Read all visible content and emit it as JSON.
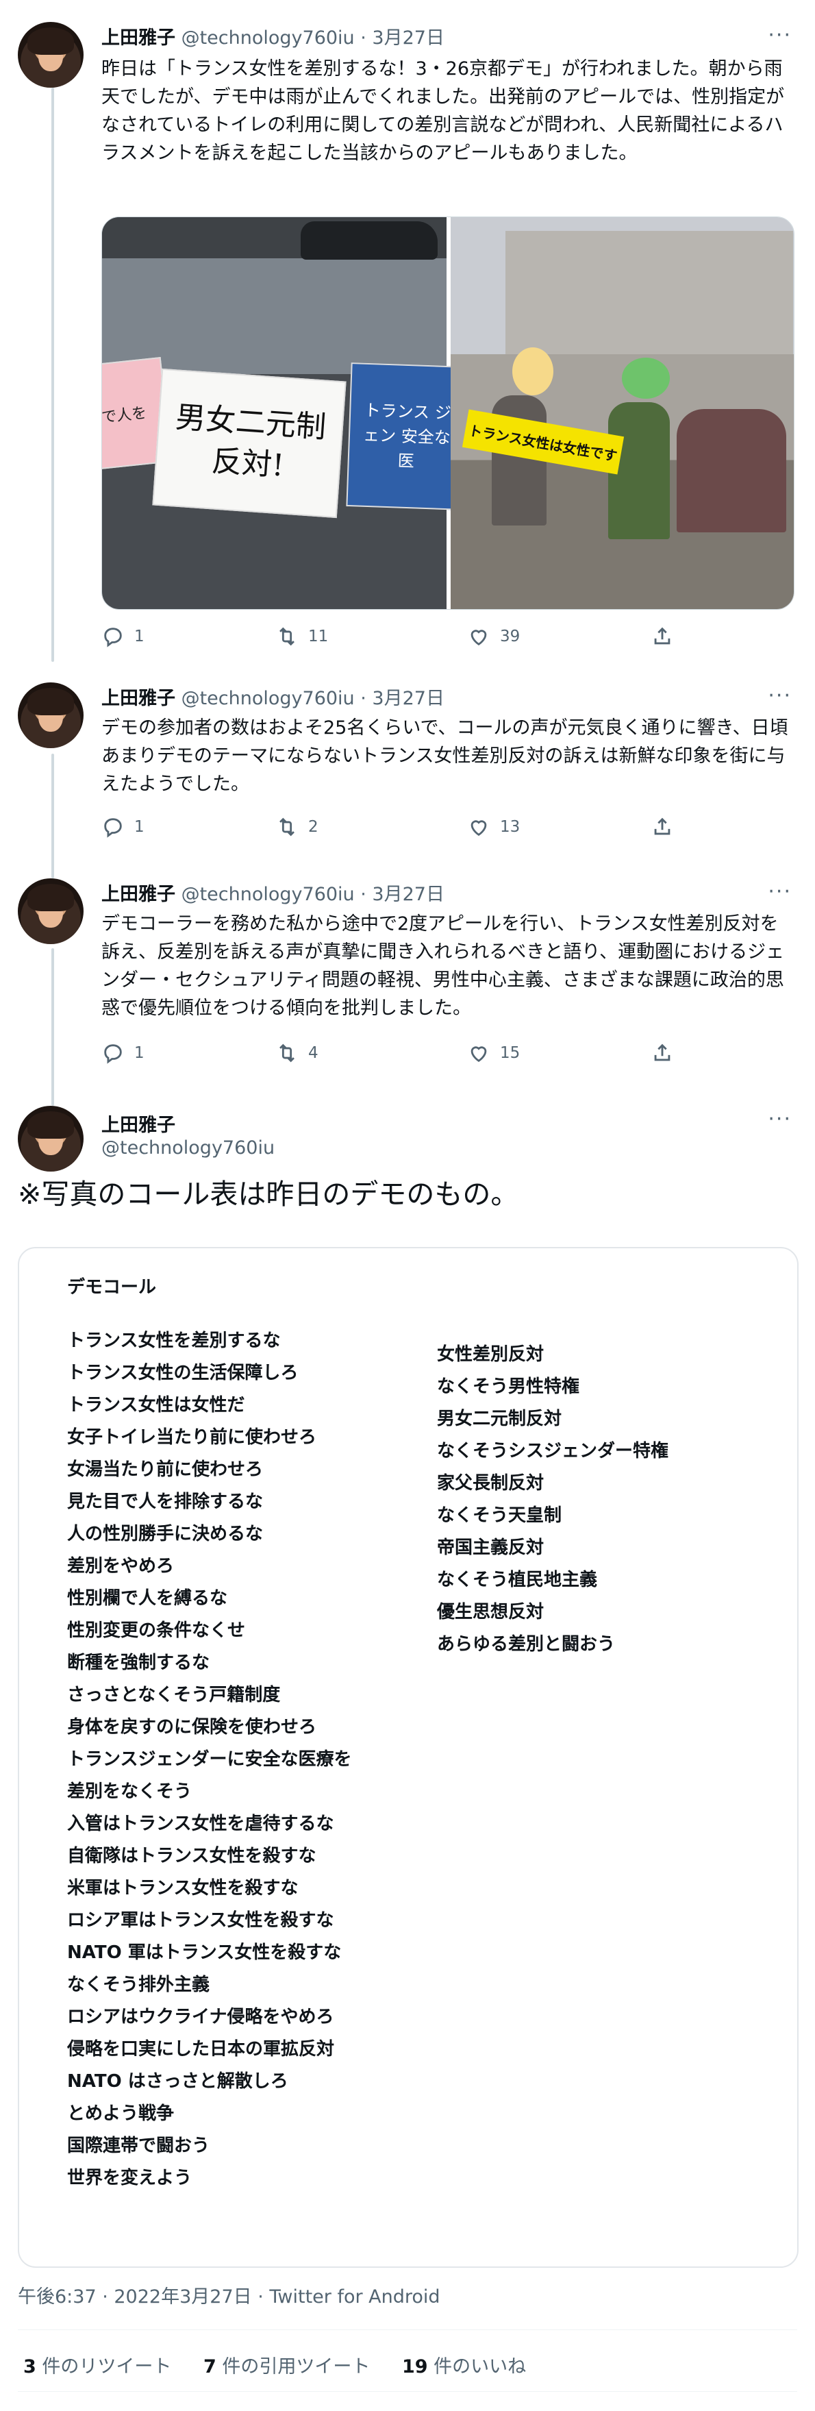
{
  "author": {
    "name": "上田雅子",
    "handle": "@technology760iu"
  },
  "tweets": [
    {
      "date": "3月27日",
      "text": "昨日は「トランス女性を差別するな！3・26京都デモ」が行われました。朝から雨天でしたが、デモ中は雨が止んでくれました。出発前のアピールでは、性別指定がなされているトイレの利用に関しての差別言説などが問われ、人民新聞社によるハラスメントを訴えを起こした当該からのアピールもありました。",
      "photo_sign_main": "男女二元制反対!",
      "photo_sign_left": "で人を",
      "photo_sign_right": "トランス ジェン 安全な医",
      "photo_banner": "トランス女性は女性です",
      "counts": {
        "reply": "1",
        "retweet": "11",
        "like": "39"
      }
    },
    {
      "date": "3月27日",
      "text": "デモの参加者の数はおよそ25名くらいで、コールの声が元気良く通りに響き、日頃あまりデモのテーマにならないトランス女性差別反対の訴えは新鮮な印象を街に与えたようでした。",
      "counts": {
        "reply": "1",
        "retweet": "2",
        "like": "13"
      }
    },
    {
      "date": "3月27日",
      "text": "デモコーラーを務めた私から途中で2度アピールを行い、トランス女性差別反対を訴え、反差別を訴える声が真摯に聞き入れられるべきと語り、運動圏におけるジェンダー・セクシュアリティ問題の軽視、男性中心主義、さまざまな課題に政治的思惑で優先順位をつける傾向を批判しました。",
      "counts": {
        "reply": "1",
        "retweet": "4",
        "like": "15"
      }
    }
  ],
  "main_tweet": {
    "text": "※写真のコール表は昨日のデモのもの。",
    "card_title": "デモコール",
    "calls_left": [
      "トランス女性を差別するな",
      "トランス女性の生活保障しろ",
      "トランス女性は女性だ",
      "女子トイレ当たり前に使わせろ",
      "女湯当たり前に使わせろ",
      "見た目で人を排除するな",
      "人の性別勝手に決めるな",
      "差別をやめろ",
      "性別欄で人を縛るな",
      "性別変更の条件なくせ",
      "断種を強制するな",
      "さっさとなくそう戸籍制度",
      "身体を戻すのに保険を使わせろ",
      "トランスジェンダーに安全な医療を",
      "差別をなくそう",
      "入管はトランス女性を虐待するな",
      "自衛隊はトランス女性を殺すな",
      "米軍はトランス女性を殺すな",
      "ロシア軍はトランス女性を殺すな",
      "NATO 軍はトランス女性を殺すな",
      "なくそう排外主義",
      "ロシアはウクライナ侵略をやめろ",
      "侵略を口実にした日本の軍拡反対",
      "NATO はさっさと解散しろ",
      "とめよう戦争",
      "国際連帯で闘おう",
      "世界を変えよう"
    ],
    "calls_right": [
      "女性差別反対",
      "なくそう男性特権",
      "男女二元制反対",
      "なくそうシスジェンダー特権",
      "家父長制反対",
      "なくそう天皇制",
      "帝国主義反対",
      "なくそう植民地主義",
      "優生思想反対",
      "あらゆる差別と闘おう"
    ],
    "timestamp": "午後6:37 · 2022年3月27日 · Twitter for Android",
    "retweets": "3",
    "retweets_label": "件のリツイート",
    "quotes": "7",
    "quotes_label": "件の引用ツイート",
    "likes": "19",
    "likes_label": "件のいいね"
  },
  "sep": " · ",
  "more_glyph": "···",
  "icons": {
    "reply": "reply-icon",
    "retweet": "retweet-icon",
    "like": "like-icon",
    "share": "share-icon",
    "more": "more-icon"
  }
}
